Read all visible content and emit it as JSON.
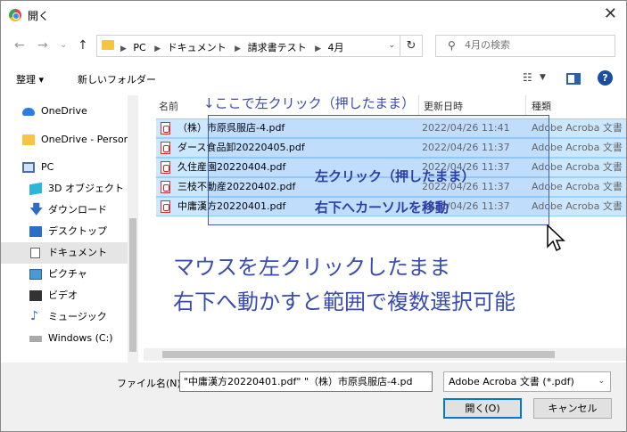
{
  "window": {
    "title": "開く",
    "close": "✕"
  },
  "nav": {
    "back": "←",
    "forward": "→",
    "recent": "⌄",
    "up": "↑",
    "breadcrumbs": [
      "PC",
      "ドキュメント",
      "請求書テスト",
      "4月"
    ],
    "refresh": "↻",
    "search_placeholder": "4月の検索"
  },
  "toolbar": {
    "organize": "整理 ▾",
    "new_folder": "新しいフォルダー",
    "help": "?"
  },
  "sidebar": {
    "items": [
      {
        "label": "OneDrive",
        "icon": "cloud-icon"
      },
      {
        "label": "OneDrive - Personal",
        "icon": "folder-icon"
      },
      {
        "label": "PC",
        "icon": "pc-icon"
      },
      {
        "label": "3D オブジェクト",
        "icon": "cube-icon"
      },
      {
        "label": "ダウンロード",
        "icon": "download-icon"
      },
      {
        "label": "デスクトップ",
        "icon": "desktop-icon"
      },
      {
        "label": "ドキュメント",
        "icon": "document-icon",
        "selected": true
      },
      {
        "label": "ピクチャ",
        "icon": "picture-icon"
      },
      {
        "label": "ビデオ",
        "icon": "video-icon"
      },
      {
        "label": "ミュージック",
        "icon": "music-icon"
      },
      {
        "label": "Windows (C:)",
        "icon": "drive-icon"
      }
    ]
  },
  "columns": {
    "name": "名前",
    "date": "更新日時",
    "type": "種類"
  },
  "files": [
    {
      "name": "（株）市原呉服店-4.pdf",
      "date": "2022/04/26 11:41",
      "type": "Adobe Acroba 文書"
    },
    {
      "name": "ダース食品卸20220405.pdf",
      "date": "2022/04/26 11:37",
      "type": "Adobe Acroba 文書"
    },
    {
      "name": "久住産園20220404.pdf",
      "date": "2022/04/26 11:37",
      "type": "Adobe Acroba 文書"
    },
    {
      "name": "三枝不動産20220402.pdf",
      "date": "2022/04/26 11:37",
      "type": "Adobe Acroba 文書"
    },
    {
      "name": "中庸漢方20220401.pdf",
      "date": "2022/04/26 11:37",
      "type": "Adobe Acroba 文書"
    }
  ],
  "annotations": {
    "top": "↓ここで左クリック（押したまま）",
    "mid1": "左クリック（押したまま）",
    "mid2": "右下へカーソルを移動",
    "big1": "マウスを左クリックしたまま",
    "big2": "右下へ動かすと範囲で複数選択可能"
  },
  "footer": {
    "filename_label": "ファイル名(N):",
    "filename_value": "\"中庸漢方20220401.pdf\" \"（株）市原呉服店-4.pd",
    "filter": "Adobe Acroba 文書 (*.pdf)",
    "open": "開く(O)",
    "cancel": "キャンセル"
  },
  "colors": {
    "selection": "#cce8ff",
    "annotation": "#3a4cb0",
    "accent": "#0078d7"
  }
}
